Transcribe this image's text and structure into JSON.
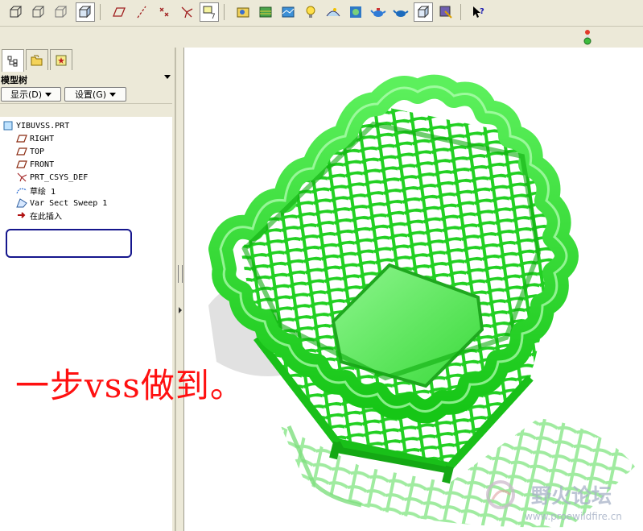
{
  "panel": {
    "title": "模型树",
    "show_button": "显示(D)",
    "settings_button": "设置(G)"
  },
  "tree": {
    "items": [
      {
        "label": "YIBUVSS.PRT",
        "icon": "part-icon"
      },
      {
        "label": "RIGHT",
        "icon": "datum-plane-icon"
      },
      {
        "label": "TOP",
        "icon": "datum-plane-icon"
      },
      {
        "label": "FRONT",
        "icon": "datum-plane-icon"
      },
      {
        "label": "PRT_CSYS_DEF",
        "icon": "coordinate-system-icon"
      },
      {
        "label": "草绘 1",
        "icon": "sketch-icon"
      },
      {
        "label": "Var Sect Sweep 1",
        "icon": "sweep-icon"
      },
      {
        "label": "在此插入",
        "icon": "insert-here-arrow-icon"
      }
    ]
  },
  "overlay": {
    "caption": "一步vss做到。"
  },
  "watermark": {
    "title": "野火论坛",
    "url": "www.proewildfire.cn"
  },
  "colors": {
    "model_green": "#1fdc1f",
    "highlight_box": "#15168d",
    "caption_red": "#ff1010"
  }
}
